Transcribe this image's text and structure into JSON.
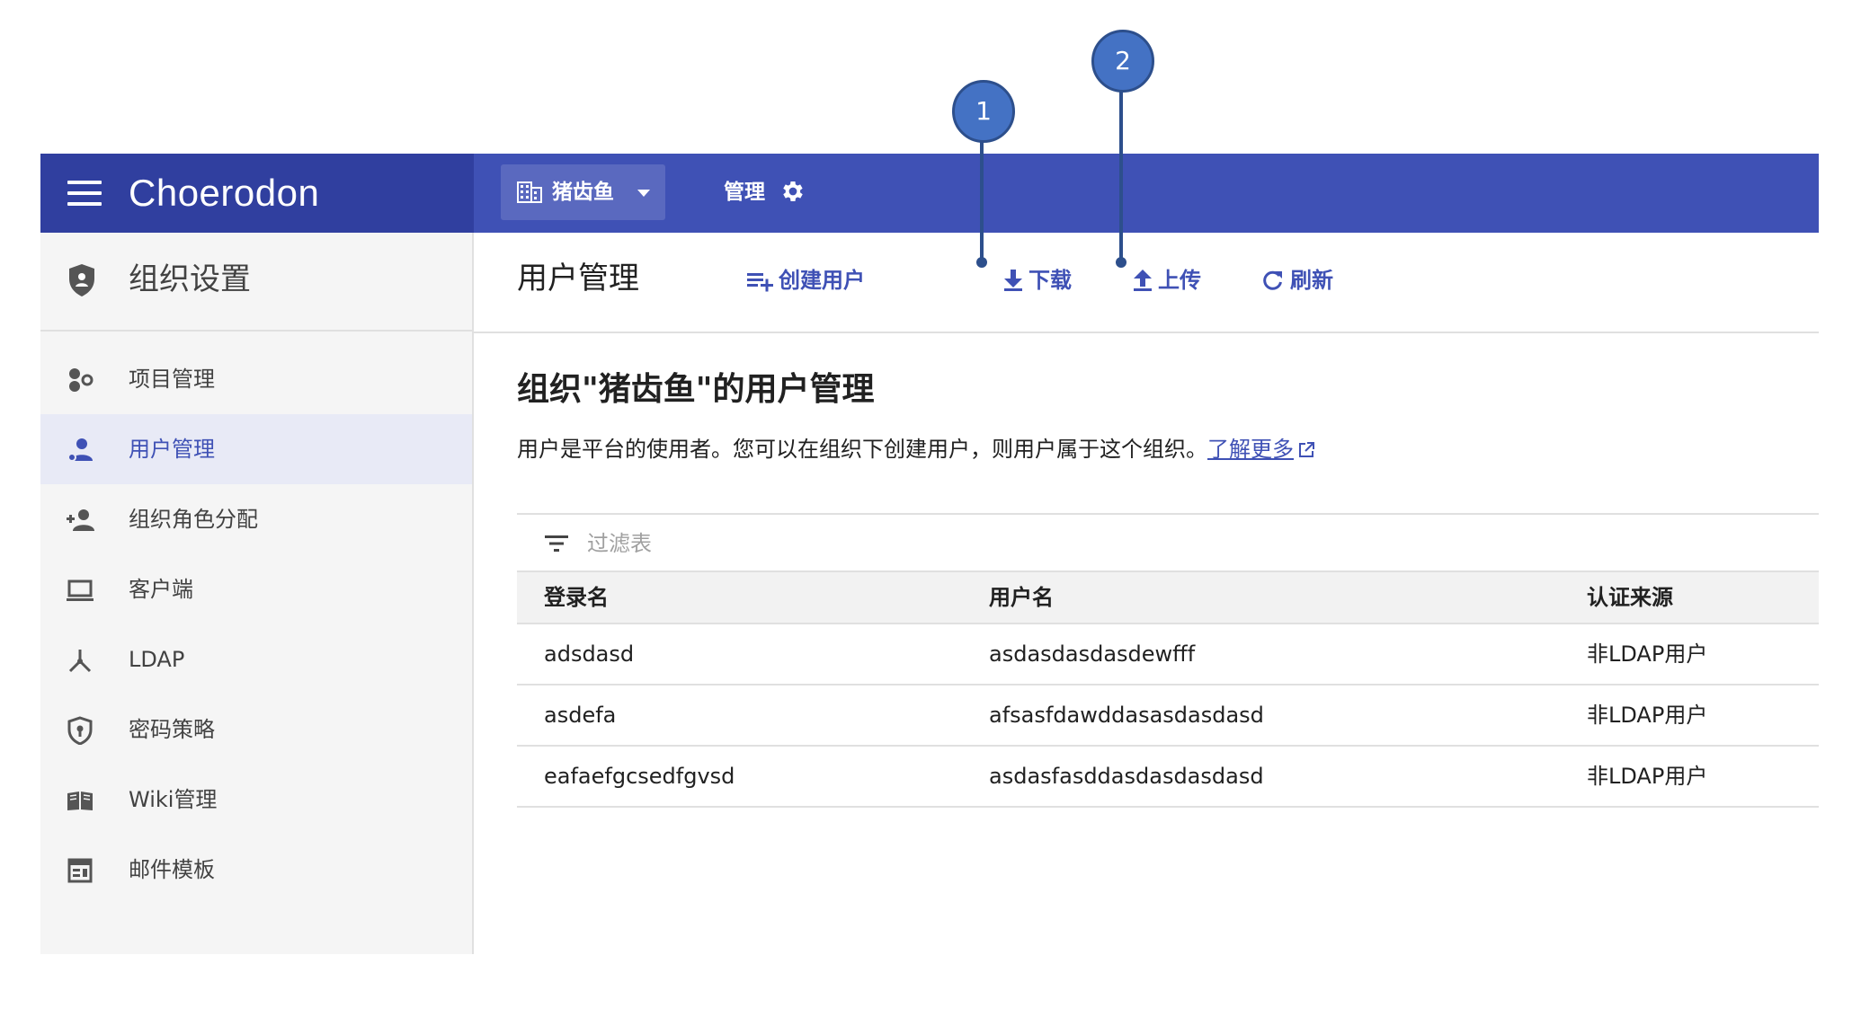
{
  "header": {
    "brand": "Choerodon",
    "org_name": "猪齿鱼",
    "manage_label": "管理",
    "colors": {
      "primary": "#3f51b5",
      "primary_dark": "#303f9f"
    }
  },
  "sidebar": {
    "title": "组织设置",
    "items": [
      {
        "label": "项目管理",
        "icon": "project-icon"
      },
      {
        "label": "用户管理",
        "icon": "user-manage-icon",
        "active": true
      },
      {
        "label": "组织角色分配",
        "icon": "person-add-icon"
      },
      {
        "label": "客户端",
        "icon": "laptop-icon"
      },
      {
        "label": "LDAP",
        "icon": "ldap-icon"
      },
      {
        "label": "密码策略",
        "icon": "password-shield-icon"
      },
      {
        "label": "Wiki管理",
        "icon": "book-icon"
      },
      {
        "label": "邮件模板",
        "icon": "template-icon"
      }
    ]
  },
  "main": {
    "page_title": "用户管理",
    "toolbar": {
      "create": "创建用户",
      "download": "下载",
      "upload": "上传",
      "refresh": "刷新"
    },
    "heading": "组织\"猪齿鱼\"的用户管理",
    "description": "用户是平台的使用者。您可以在组织下创建用户，则用户属于这个组织。",
    "learn_more": "了解更多",
    "filter_placeholder": "过滤表",
    "table": {
      "columns": [
        "登录名",
        "用户名",
        "认证来源"
      ],
      "rows": [
        [
          "adsdasd",
          "asdasdasdasdewfff",
          "非LDAP用户"
        ],
        [
          "asdefa",
          "afsasfdawddasasdasdasd",
          "非LDAP用户"
        ],
        [
          "eafaefgcsedfgvsd",
          "asdasfasddasdasdasdasd",
          "非LDAP用户"
        ]
      ]
    }
  },
  "callouts": [
    "1",
    "2"
  ]
}
